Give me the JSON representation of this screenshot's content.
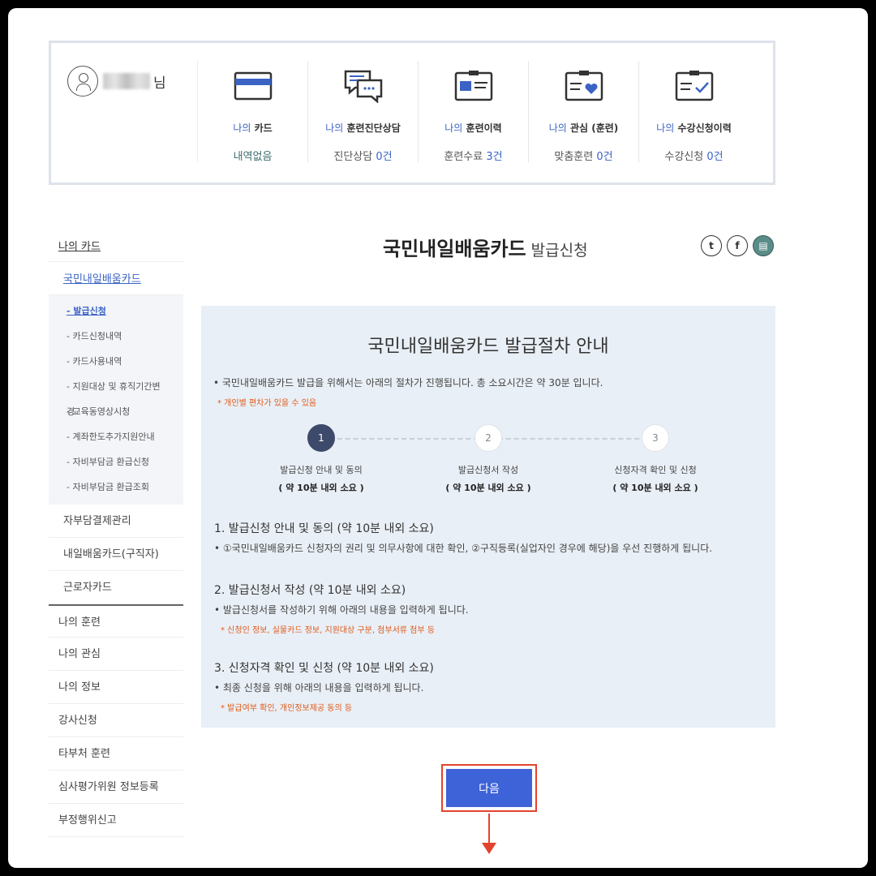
{
  "user": {
    "suffix": "님"
  },
  "summary": [
    {
      "prefix": "나의",
      "title": "카드",
      "value_text": "내역없음",
      "count": "",
      "icon": "card-icon"
    },
    {
      "prefix": "나의",
      "title": "훈련진단상담",
      "value_text": "진단상담 ",
      "count": "0건",
      "icon": "chat-icon"
    },
    {
      "prefix": "나의",
      "title": "훈련이력",
      "value_text": "훈련수료 ",
      "count": "3건",
      "icon": "id-card-icon"
    },
    {
      "prefix": "나의",
      "title": "관심 (훈련)",
      "value_text": "맞춤훈련 ",
      "count": "0건",
      "icon": "heart-clipboard-icon"
    },
    {
      "prefix": "나의",
      "title": "수강신청이력",
      "value_text": "수강신청 ",
      "count": "0건",
      "icon": "check-clipboard-icon"
    }
  ],
  "nav": {
    "top": "나의 카드",
    "sub1": "국민내일배움카드",
    "sub2": [
      "- 발급신청",
      "- 카드신청내역",
      "- 카드사용내역",
      "- 지원대상 및 휴직기간변경",
      "- 교육동영상시청",
      "- 계좌한도추가지원안내",
      "- 자비부담금 환급신청",
      "- 자비부담금 환급조회"
    ],
    "sub1_more": [
      "자부담결제관리",
      "내일배움카드(구직자)",
      "근로자카드"
    ],
    "items": [
      "나의 훈련",
      "나의 관심",
      "나의 정보",
      "강사신청",
      "타부처 훈련",
      "심사평가위원 정보등록",
      "부정행위신고"
    ]
  },
  "page": {
    "title": "국민내일배움카드",
    "subtitle": "발급신청"
  },
  "share": {
    "twitter": "t",
    "facebook": "f",
    "print": "▤"
  },
  "guide": {
    "title": "국민내일배움카드 발급절차 안내",
    "intro": "• 국민내일배움카드 발급을 위해서는 아래의 절차가 진행됩니다. 총 소요시간은 약 30분 입니다.",
    "note": "* 개인별 편차가 있을 수 있음",
    "steps": [
      {
        "num": "1",
        "label": "발급신청 안내 및 동의",
        "time": "( 약 10분 내외 소요 )"
      },
      {
        "num": "2",
        "label": "발급신청서 작성",
        "time": "( 약 10분 내외 소요 )"
      },
      {
        "num": "3",
        "label": "신청자격 확인 및 신청",
        "time": "( 약 10분 내외 소요 )"
      }
    ],
    "sections": [
      {
        "heading": "1. 발급신청 안내 및 동의 (약 10분 내외 소요)",
        "text": "• ①국민내일배움카드 신청자의 권리 및 의무사항에 대한 확인, ②구직등록(실업자인 경우에 해당)을 우선 진행하게 됩니다.",
        "note": ""
      },
      {
        "heading": "2. 발급신청서 작성 (약 10분 내외 소요)",
        "text": "• 발급신청서를 작성하기 위해 아래의 내용을 입력하게 됩니다.",
        "note": "* 신청인 정보, 실물카드 정보, 지원대상 구분, 첨부서류 첨부 등"
      },
      {
        "heading": "3. 신청자격 확인 및 신청 (약 10분 내외 소요)",
        "text": "• 최종 신청을 위해 아래의 내용을 입력하게 됩니다.",
        "note": "* 발급여부 확인, 개인정보제공 동의 등"
      }
    ]
  },
  "next_button": "다음",
  "colors": {
    "accent": "#3b63c4",
    "button": "#3e63d8",
    "highlight": "#e3432c",
    "note": "#e05a1a",
    "panel": "#e9eff6"
  }
}
